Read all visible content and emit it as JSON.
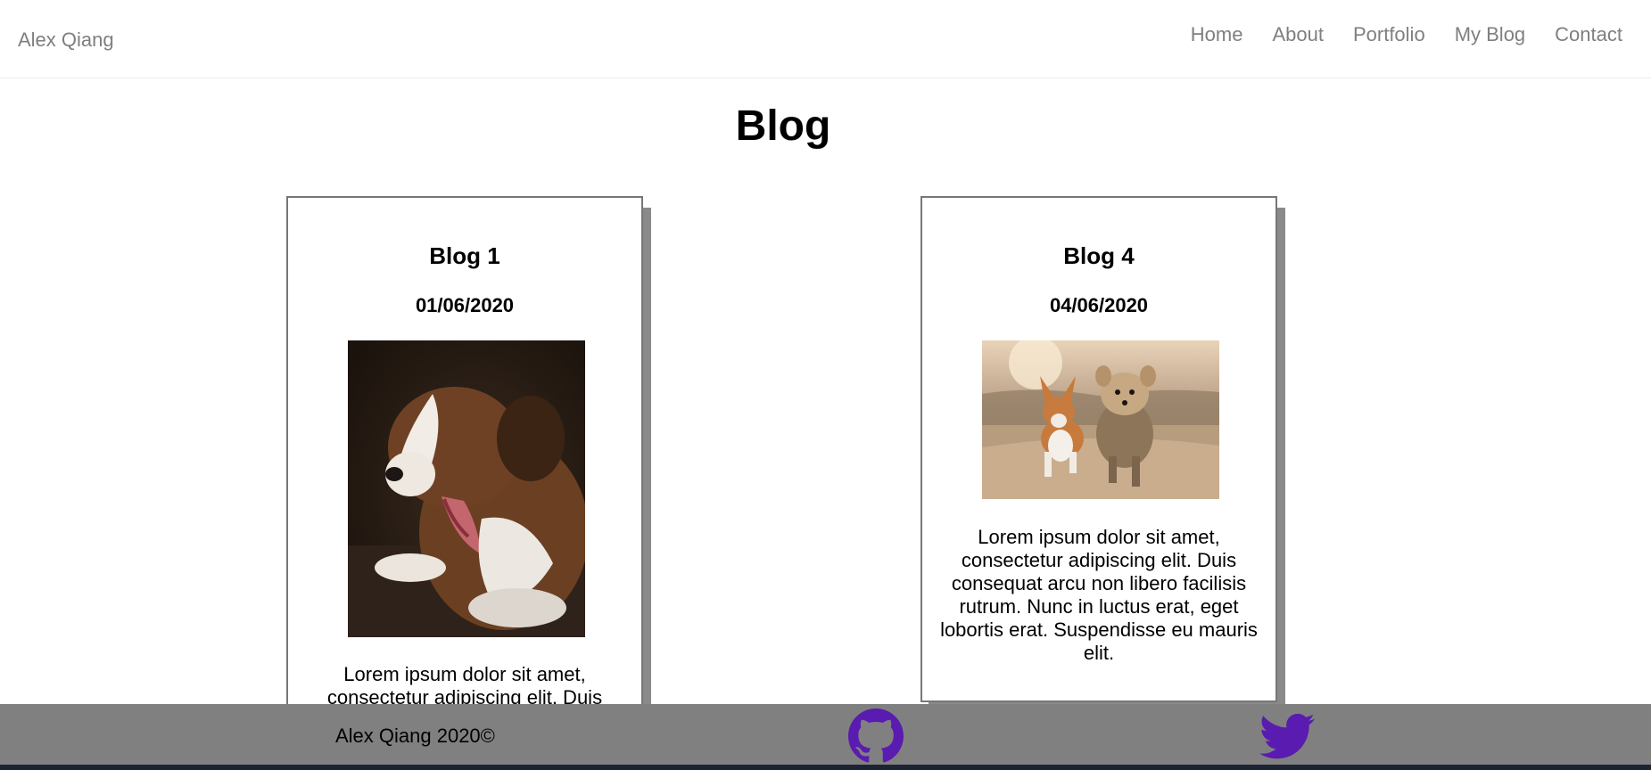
{
  "navbar": {
    "brand": "Alex Qiang",
    "links": [
      "Home",
      "About",
      "Portfolio",
      "My Blog",
      "Contact"
    ]
  },
  "page": {
    "title": "Blog"
  },
  "blogs": [
    {
      "title": "Blog 1",
      "date": "01/06/2020",
      "image": "puppy-yawning-photo",
      "text": "Lorem ipsum dolor sit amet, consectetur adipiscing elit. Duis"
    },
    {
      "title": "Blog 4",
      "date": "04/06/2020",
      "image": "two-dogs-running-photo",
      "text": "Lorem ipsum dolor sit amet, consectetur adipiscing elit. Duis consequat arcu non libero facilisis rutrum. Nunc in luctus erat, eget lobortis erat. Suspendisse eu mauris elit."
    }
  ],
  "footer": {
    "copyright": "Alex Qiang 2020©",
    "icons": [
      "github-icon",
      "twitter-icon"
    ],
    "icon_color": "#5a1bb0"
  },
  "colors": {
    "nav_text": "#7f7f7f",
    "footer_bg": "#808080",
    "card_border": "#777777",
    "card_shadow": "#8a8a8a"
  }
}
